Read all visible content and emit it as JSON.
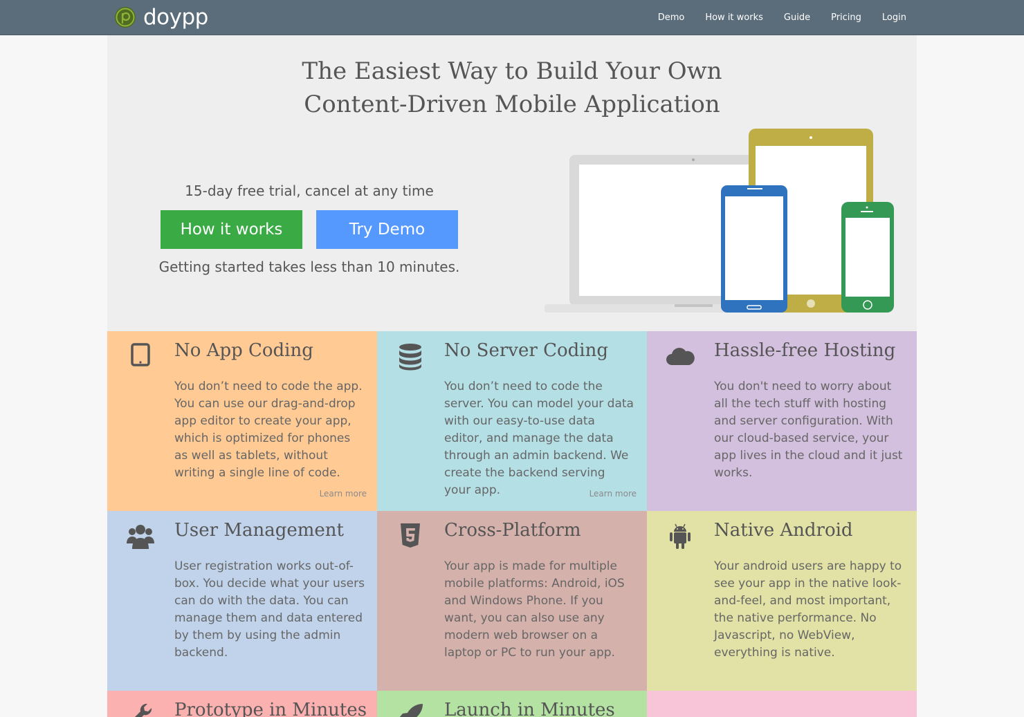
{
  "brand": {
    "name": "doypp",
    "logo_color": "#7aa02d"
  },
  "nav": {
    "items": [
      "Demo",
      "How it works",
      "Guide",
      "Pricing",
      "Login"
    ],
    "background": "#5b6c7a"
  },
  "hero": {
    "title_line1": "The Easiest Way to Build Your Own",
    "title_line2": "Content-Driven Mobile Application",
    "trial_text": "15-day free trial, cancel at any time",
    "how_it_works_label": "How it works",
    "try_demo_label": "Try Demo",
    "started_text": "Getting started takes less than 10 minutes."
  },
  "features": [
    {
      "title": "No App Coding",
      "icon": "tablet-icon",
      "color": "#ffca94",
      "text": "You don’t need to code the app. You can use our drag-and-drop app editor to create your app, which is optimized for phones as well as tablets, without writing a single line of code.",
      "learn_more": "Learn more"
    },
    {
      "title": "No Server Coding",
      "icon": "database-icon",
      "color": "#b4dfe5",
      "text": "You don’t need to code the server. You can model your data with our easy-to-use data editor, and manage the data through an admin backend. We create the backend serving your app.",
      "learn_more": "Learn more"
    },
    {
      "title": "Hassle-free Hosting",
      "icon": "cloud-icon",
      "color": "#d3c0de",
      "text": "You don't need to worry about all the tech stuff with hosting and server configuration. With our cloud-based service, your app lives in the cloud and it just works.",
      "learn_more": ""
    },
    {
      "title": "User Management",
      "icon": "users-icon",
      "color": "#c0d3ea",
      "text": "User registration works out-of-box. You decide what your users can do with the data. You can manage them and data entered by them by using the admin backend.",
      "learn_more": ""
    },
    {
      "title": "Cross-Platform",
      "icon": "html5-icon",
      "color": "#d4b1ab",
      "text": "Your app is made for multiple mobile platforms: Android, iOS and Windows Phone. If you want, you can also use any modern web browser on a laptop or PC to run your app.",
      "learn_more": ""
    },
    {
      "title": "Native Android",
      "icon": "android-icon",
      "color": "#e2e2a6",
      "text": "Your android users are happy to see your app in the native look-and-feel, and most important, the native performance. No Javascript, no WebView, everything is native.",
      "learn_more": ""
    },
    {
      "title": "Prototype in Minutes",
      "icon": "wrench-icon",
      "color": "#fcb1b1",
      "text": "",
      "learn_more": ""
    },
    {
      "title": "Launch in Minutes",
      "icon": "rocket-icon",
      "color": "#b4e2a2",
      "text": "",
      "learn_more": ""
    },
    {
      "title": "",
      "icon": "",
      "color": "#f7c4d8",
      "text": "",
      "learn_more": ""
    }
  ]
}
